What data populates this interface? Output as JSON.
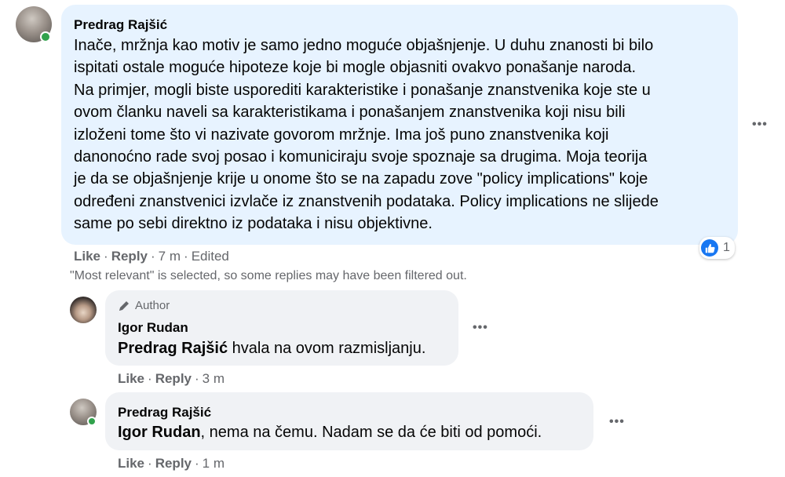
{
  "comment": {
    "author": "Predrag Rajšić",
    "lines": [
      "Inače, mržnja kao motiv je samo jedno moguće objašnjenje. U duhu znanosti bi bilo",
      "ispitati ostale moguće hipoteze koje bi mogle objasniti ovakvo ponašanje naroda.",
      "Na primjer, mogli biste usporediti karakteristike i ponašanje znanstvenika koje ste u",
      "ovom članku naveli sa karakteristikama i ponašanjem znanstvenika koji nisu bili",
      "izloženi tome što vi nazivate govorom mržnje. Ima još puno znanstvenika koji",
      "danonoćno rade svoj posao i komuniciraju svoje spoznaje sa drugima. Moja teorija",
      "je da se objašnjenje krije u onome što se na zapadu zove \"policy implications\" koje",
      "određeni znanstvenici izvlače iz znanstvenih podataka. Policy implications ne slijede",
      "same po sebi direktno iz podataka i nisu objektivne."
    ],
    "like": "Like",
    "reply": "Reply",
    "time": "7 m",
    "edited": "Edited",
    "reaction_count": "1"
  },
  "filter_note": "\"Most relevant\" is selected, so some replies may have been filtered out.",
  "replies": [
    {
      "author_badge": "Author",
      "author": "Igor Rudan",
      "mention": "Predrag Rajšić",
      "text": " hvala na ovom razmisljanju.",
      "like": "Like",
      "reply": "Reply",
      "time": "3 m"
    },
    {
      "author": "Predrag Rajšić",
      "mention": "Igor Rudan",
      "text": ", nema na čemu. Nadam se da će biti od pomoći.",
      "like": "Like",
      "reply": "Reply",
      "time": "1 m"
    }
  ],
  "more_symbol": "•••",
  "colors": {
    "main_bubble": "#e7f3ff",
    "reply_bubble": "#f0f2f5",
    "secondary_text": "#65676b",
    "like_blue": "#1877f2",
    "online_green": "#31a24c"
  }
}
